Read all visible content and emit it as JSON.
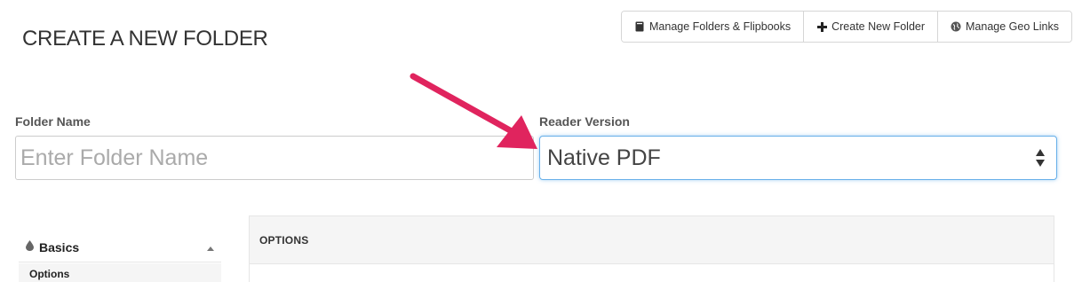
{
  "header": {
    "title": "CREATE A NEW FOLDER"
  },
  "toolbar": {
    "buttons": [
      {
        "label": "Manage Folders & Flipbooks",
        "icon": "book-icon"
      },
      {
        "label": "Create New Folder",
        "icon": "plus-icon"
      },
      {
        "label": "Manage Geo Links",
        "icon": "globe-icon"
      }
    ]
  },
  "form": {
    "folder_name": {
      "label": "Folder Name",
      "placeholder": "Enter Folder Name",
      "value": ""
    },
    "reader_version": {
      "label": "Reader Version",
      "selected": "Native PDF"
    }
  },
  "sidebar": {
    "section": {
      "label": "Basics",
      "icon": "drop-icon",
      "toggle_icon": "caret-up-icon"
    },
    "items": [
      {
        "label": "Options"
      }
    ]
  },
  "panel": {
    "heading": "OPTIONS"
  },
  "annotation": {
    "arrow_color": "#e0245e"
  },
  "colors": {
    "focus_border": "#66afe9",
    "panel_bg": "#f5f5f5"
  }
}
